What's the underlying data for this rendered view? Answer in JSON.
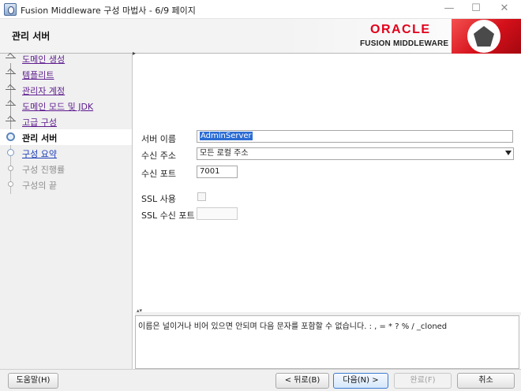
{
  "window": {
    "title": "Fusion Middleware 구성 마법사 - 6/9 페이지",
    "minimize_glyph": "—",
    "maximize_glyph": "☐",
    "close_glyph": "✕"
  },
  "header": {
    "page_title": "관리 서버",
    "brand_line1": "ORACLE",
    "brand_line2": "FUSION MIDDLEWARE",
    "brand_color": "#e2001a"
  },
  "steps": [
    {
      "label": "도메인 생성",
      "state": "done",
      "icon": "checkmark-icon"
    },
    {
      "label": "템플리트",
      "state": "done",
      "icon": "checkmark-icon"
    },
    {
      "label": "관리자 계정",
      "state": "done",
      "icon": "checkmark-icon"
    },
    {
      "label": "도메인 모드 및 JDK",
      "state": "done",
      "icon": "checkmark-icon"
    },
    {
      "label": "고급 구성",
      "state": "done",
      "icon": "checkmark-icon"
    },
    {
      "label": "관리 서버",
      "state": "current",
      "icon": "current-step-icon"
    },
    {
      "label": "구성 요약",
      "state": "next",
      "icon": "step-circle-icon"
    },
    {
      "label": "구성 진행률",
      "state": "future",
      "icon": "step-circle-icon"
    },
    {
      "label": "구성의 끝",
      "state": "future",
      "icon": "step-circle-icon"
    }
  ],
  "form": {
    "server_name_label": "서버 이름",
    "server_name_value": "AdminServer",
    "listen_address_label": "수신 주소",
    "listen_address_value": "모든 로컬 주소",
    "listen_port_label": "수신 포트",
    "listen_port_value": "7001",
    "ssl_enabled_label": "SSL 사용",
    "ssl_enabled_checked": false,
    "ssl_port_label": "SSL 수신 포트",
    "ssl_port_value": ""
  },
  "message": {
    "text": "이름은 널이거나 비어 있으면 안되며 다음 문자를 포함할 수 없습니다. : , = * ? % / _cloned"
  },
  "buttons": {
    "help": "도움말(H)",
    "back": "< 뒤로(B)",
    "next": "다음(N) >",
    "finish": "완료(F)",
    "cancel": "취소"
  }
}
